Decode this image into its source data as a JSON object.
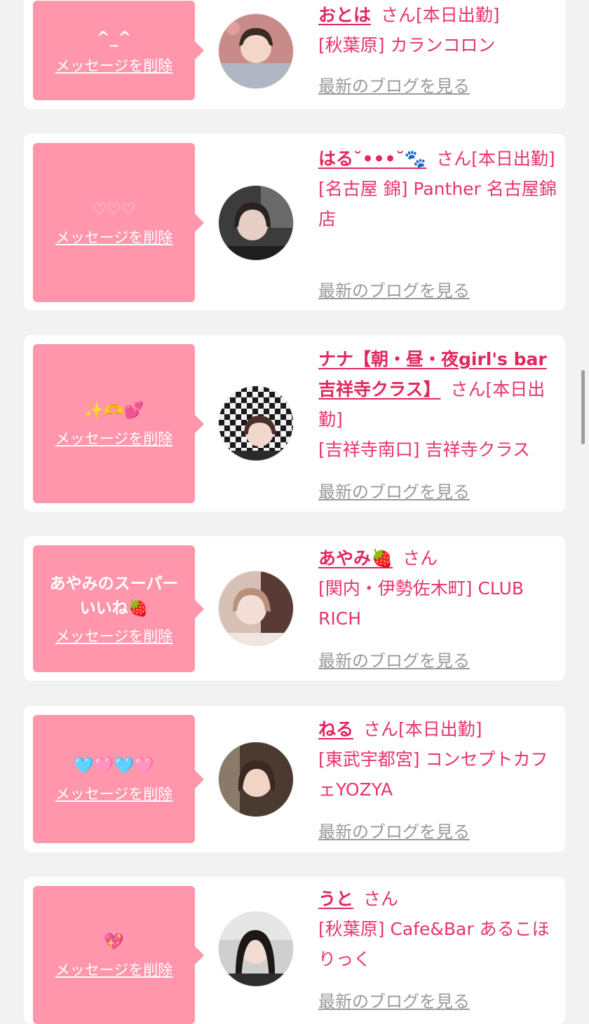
{
  "delete_label": "メッセージを削除",
  "blog_label": "最新のブログを見る",
  "san": "さん",
  "colors": {
    "accent": "#e8346a",
    "bubble": "#ff96ac",
    "background": "#f2f2f2",
    "link_gray": "#9a9a9a"
  },
  "cards": [
    {
      "message": "^_^",
      "name": "おとは",
      "status": "[本日出勤]",
      "shop": "[秋葉原] カランコロン"
    },
    {
      "message": "♡♡♡",
      "name": "はる˘•••˘🐾",
      "status": "[本日出勤]",
      "shop": "[名古屋 錦] Panther 名古屋錦店"
    },
    {
      "message": "✨🫶💕",
      "name": "ナナ【朝・昼・夜girl's bar吉祥寺クラス】",
      "status": "[本日出勤]",
      "shop": "[吉祥寺南口] 吉祥寺クラス"
    },
    {
      "message": "あやみのスーパー\nいいね🍓",
      "name": "あやみ🍓",
      "status": "",
      "shop": "[関内・伊勢佐木町] CLUB RICH"
    },
    {
      "message": "🩵🩷🩵🩷",
      "name": "ねる",
      "status": "[本日出勤]",
      "shop": "[東武宇都宮] コンセプトカフェYOZYA"
    },
    {
      "message": "💖",
      "name": "うと",
      "status": "",
      "shop": "[秋葉原] Cafe&Bar あるこほりっく"
    }
  ]
}
